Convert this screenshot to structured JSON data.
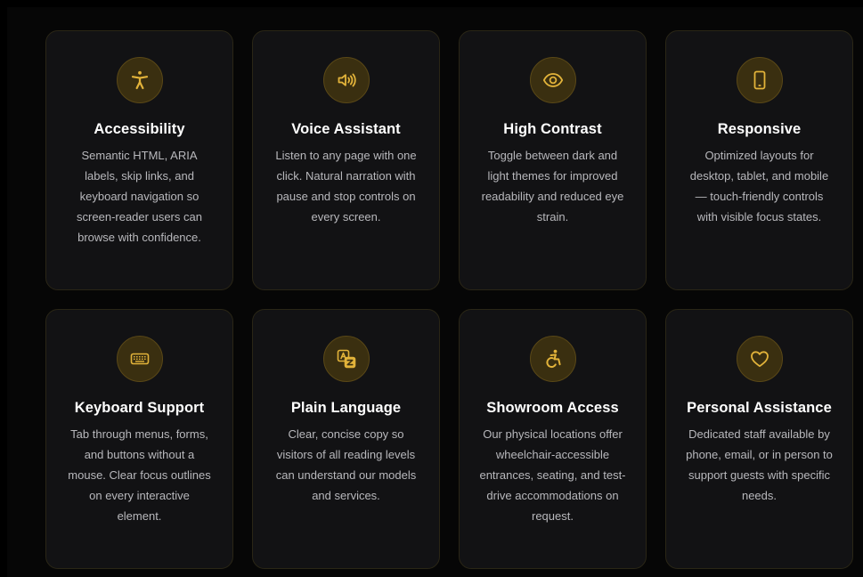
{
  "colors": {
    "background": "#000000",
    "card": "#121214",
    "card_border": "#2a2616",
    "accent": "#e2b33a",
    "icon_circle": "#3a2f10",
    "title": "#ffffff",
    "text": "#b8b8bc"
  },
  "features": [
    {
      "icon": "accessibility-person-icon",
      "title": "Accessibility",
      "description": "Semantic HTML, ARIA labels, skip links, and keyboard navigation so screen-reader users can browse with confidence."
    },
    {
      "icon": "speaker-volume-icon",
      "title": "Voice Assistant",
      "description": "Listen to any page with one click. Natural narration with pause and stop controls on every screen."
    },
    {
      "icon": "eye-icon",
      "title": "High Contrast",
      "description": "Toggle between dark and light themes for improved readability and reduced eye strain."
    },
    {
      "icon": "mobile-phone-icon",
      "title": "Responsive",
      "description": "Optimized layouts for desktop, tablet, and mobile — touch-friendly controls with visible focus states."
    },
    {
      "icon": "keyboard-icon",
      "title": "Keyboard Support",
      "description": "Tab through menus, forms, and buttons without a mouse. Clear focus outlines on every interactive element."
    },
    {
      "icon": "translate-icon",
      "title": "Plain Language",
      "description": "Clear, concise copy so visitors of all reading levels can understand our models and services."
    },
    {
      "icon": "wheelchair-icon",
      "title": "Showroom Access",
      "description": "Our physical locations offer wheelchair-accessible entrances, seating, and test-drive accommodations on request."
    },
    {
      "icon": "heart-icon",
      "title": "Personal Assistance",
      "description": "Dedicated staff available by phone, email, or in person to support guests with specific needs."
    }
  ]
}
